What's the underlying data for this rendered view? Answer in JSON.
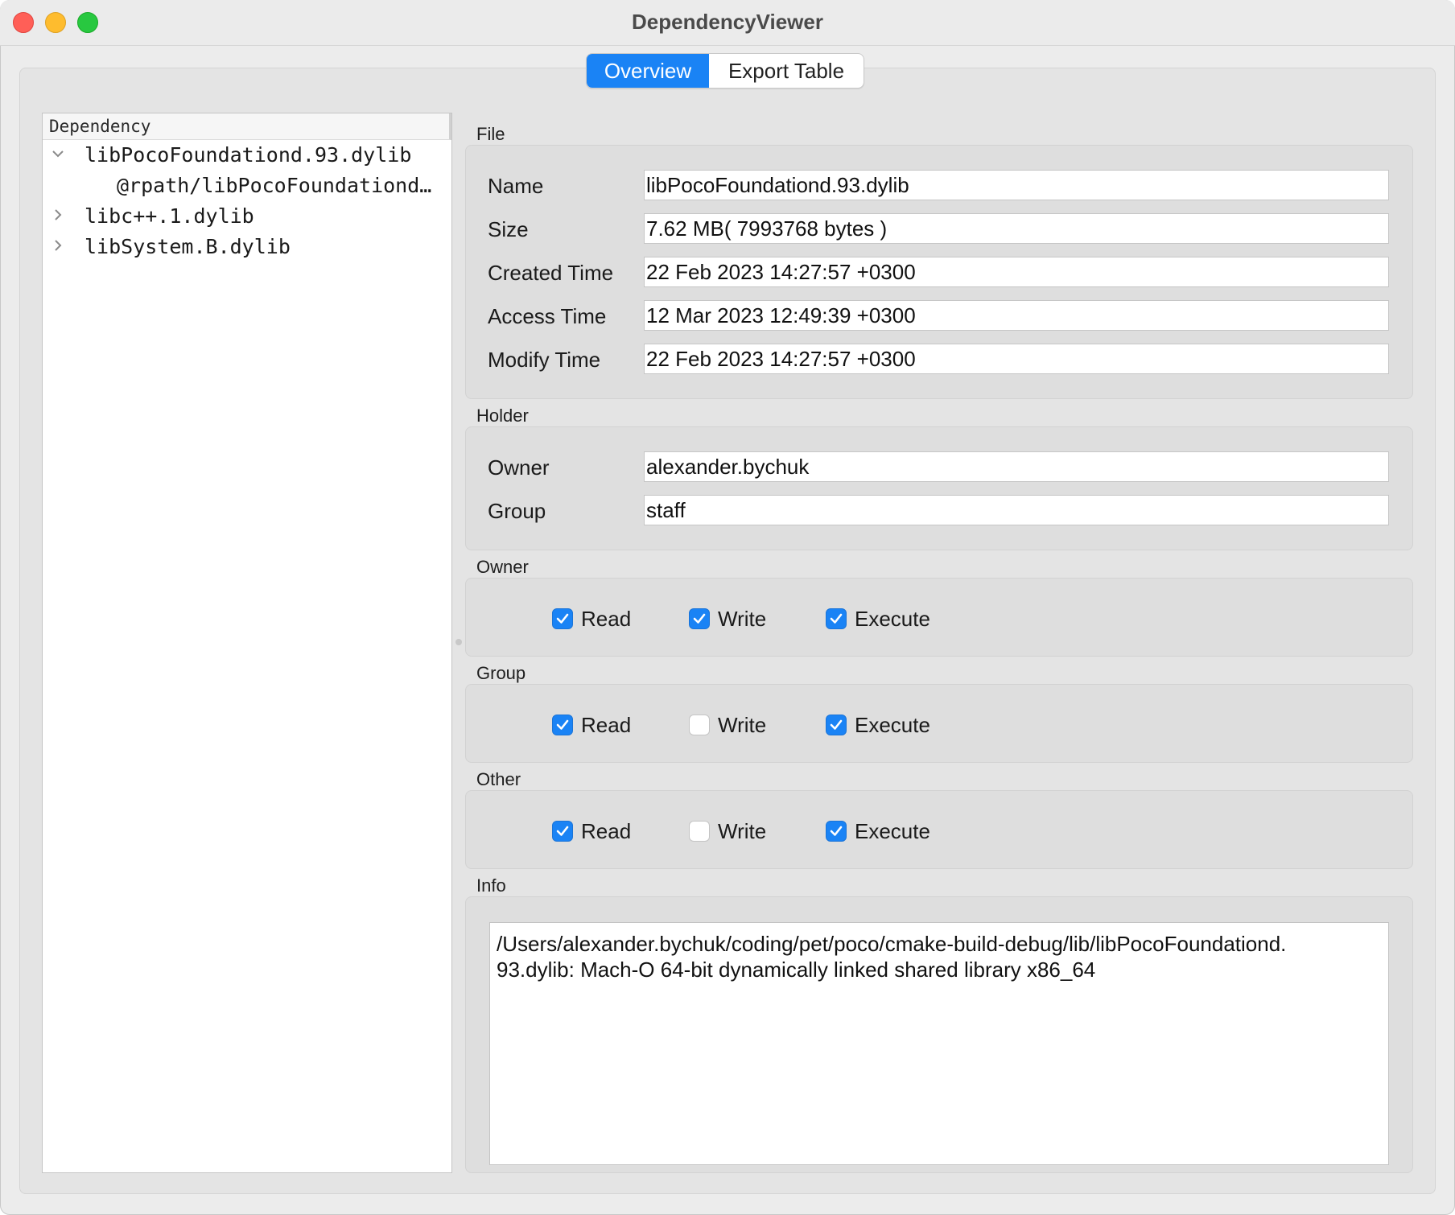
{
  "window": {
    "title": "DependencyViewer"
  },
  "tabs": [
    {
      "label": "Overview",
      "active": true
    },
    {
      "label": "Export Table",
      "active": false
    }
  ],
  "tree": {
    "header": "Dependency",
    "items": [
      {
        "label": "libPocoFoundationd.93.dylib",
        "expanded": true,
        "icon": "chevron-down-icon"
      },
      {
        "label": "@rpath/libPocoFoundationd…",
        "child": true
      },
      {
        "label": "libc++.1.dylib",
        "expanded": false,
        "icon": "chevron-right-icon"
      },
      {
        "label": "libSystem.B.dylib",
        "expanded": false,
        "icon": "chevron-right-icon"
      }
    ]
  },
  "file": {
    "title": "File",
    "fields": [
      {
        "label": "Name",
        "value": "libPocoFoundationd.93.dylib"
      },
      {
        "label": "Size",
        "value": "7.62 MB( 7993768 bytes )"
      },
      {
        "label": "Created Time",
        "value": "22 Feb 2023 14:27:57 +0300"
      },
      {
        "label": "Access Time",
        "value": "12 Mar 2023 12:49:39 +0300"
      },
      {
        "label": "Modify Time",
        "value": "22 Feb 2023 14:27:57 +0300"
      }
    ]
  },
  "holder": {
    "title": "Holder",
    "fields": [
      {
        "label": "Owner",
        "value": "alexander.bychuk"
      },
      {
        "label": "Group",
        "value": "staff"
      }
    ]
  },
  "permissions": [
    {
      "title": "Owner",
      "read": "Read",
      "write": "Write",
      "execute": "Execute",
      "read_checked": true,
      "write_checked": true,
      "execute_checked": true
    },
    {
      "title": "Group",
      "read": "Read",
      "write": "Write",
      "execute": "Execute",
      "read_checked": true,
      "write_checked": false,
      "execute_checked": true
    },
    {
      "title": "Other",
      "read": "Read",
      "write": "Write",
      "execute": "Execute",
      "read_checked": true,
      "write_checked": false,
      "execute_checked": true
    }
  ],
  "info": {
    "title": "Info",
    "text": "/Users/alexander.bychuk/coding/pet/poco/cmake-build-debug/lib/libPocoFoundationd.\n93.dylib: Mach-O 64-bit dynamically linked shared library x86_64"
  },
  "colors": {
    "accent": "#1a83f5",
    "close": "#ff5f57",
    "minimize": "#febc2e",
    "maximize": "#28c840"
  }
}
